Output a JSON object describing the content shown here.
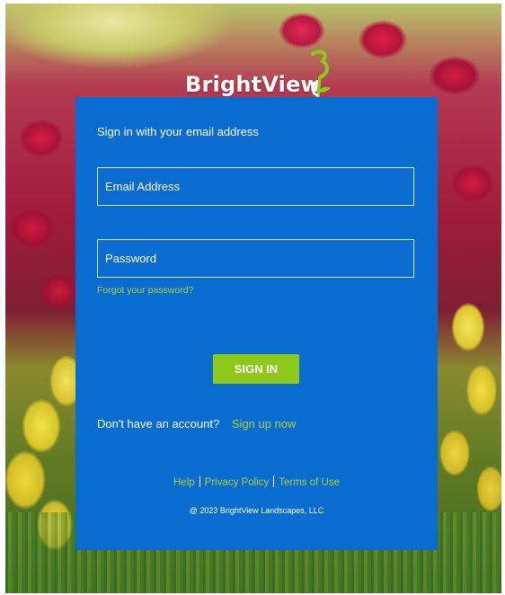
{
  "brand": {
    "name": "BrightView",
    "logo_icon": "brightview-sprout-icon",
    "accent_color": "#8cc919",
    "panel_color": "#0a6ccf"
  },
  "form": {
    "heading": "Sign in with your email address",
    "email_placeholder": "Email Address",
    "password_placeholder": "Password",
    "forgot_label": "Forgot your password?",
    "signin_label": "SIGN IN"
  },
  "signup": {
    "question": "Don't have an account?",
    "link_label": "Sign up now"
  },
  "footer": {
    "links": [
      "Help",
      "Privacy Policy",
      "Terms of Use"
    ],
    "copyright": "@ 2023 BrightView Landscapes, LLC"
  }
}
